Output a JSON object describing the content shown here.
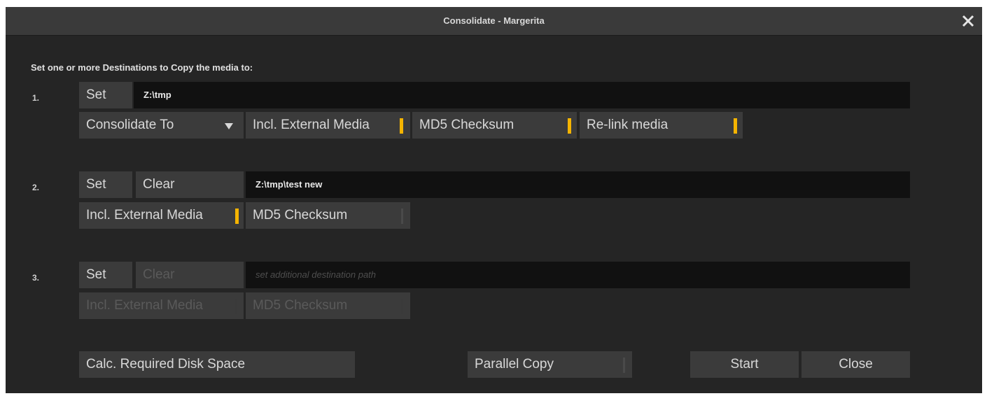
{
  "window": {
    "title": "Consolidate - Margerita",
    "close_icon": "close-icon"
  },
  "heading": "Set one or more Destinations to Copy the media to:",
  "destinations": [
    {
      "number": "1.",
      "set_label": "Set",
      "path": "Z:\\tmp",
      "mode_select": "Consolidate To",
      "incl_external_label": "Incl. External Media",
      "incl_external_on": true,
      "md5_label": "MD5 Checksum",
      "md5_on": true,
      "relink_label": "Re-link media",
      "relink_on": true
    },
    {
      "number": "2.",
      "set_label": "Set",
      "clear_label": "Clear",
      "path": "Z:\\tmp\\test new",
      "incl_external_label": "Incl. External Media",
      "incl_external_on": true,
      "md5_label": "MD5 Checksum",
      "md5_on": false
    },
    {
      "number": "3.",
      "set_label": "Set",
      "clear_label": "Clear",
      "path_placeholder": "set additional destination path",
      "incl_external_label": "Incl. External Media",
      "incl_external_on": false,
      "md5_label": "MD5 Checksum",
      "md5_on": false
    }
  ],
  "footer": {
    "calc_label": "Calc. Required Disk Space",
    "parallel_label": "Parallel Copy",
    "parallel_on": false,
    "start_label": "Start",
    "close_label": "Close"
  },
  "colors": {
    "accent": "#f5b400",
    "background": "#252525",
    "button": "#3b3b3b",
    "field": "#111111"
  }
}
